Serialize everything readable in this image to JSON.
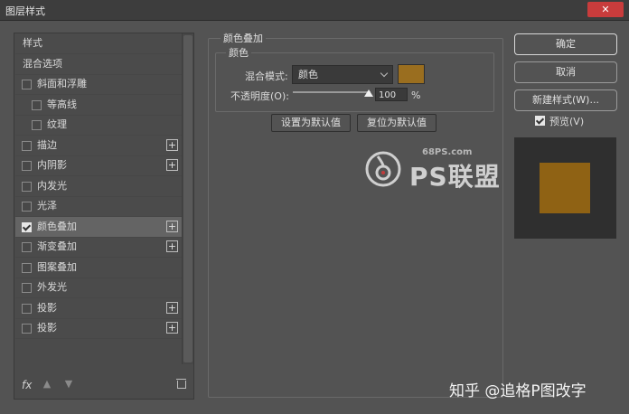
{
  "window": {
    "title": "图层样式",
    "close_label": "✕"
  },
  "left_panel": {
    "items": [
      {
        "label": "样式",
        "checkbox": false,
        "checked": false,
        "plus": false,
        "indent": 0,
        "selected": false
      },
      {
        "label": "混合选项",
        "checkbox": false,
        "checked": false,
        "plus": false,
        "indent": 0,
        "selected": false
      },
      {
        "label": "斜面和浮雕",
        "checkbox": true,
        "checked": false,
        "plus": false,
        "indent": 0,
        "selected": false
      },
      {
        "label": "等高线",
        "checkbox": true,
        "checked": false,
        "plus": false,
        "indent": 1,
        "selected": false
      },
      {
        "label": "纹理",
        "checkbox": true,
        "checked": false,
        "plus": false,
        "indent": 1,
        "selected": false
      },
      {
        "label": "描边",
        "checkbox": true,
        "checked": false,
        "plus": true,
        "indent": 0,
        "selected": false
      },
      {
        "label": "内阴影",
        "checkbox": true,
        "checked": false,
        "plus": true,
        "indent": 0,
        "selected": false
      },
      {
        "label": "内发光",
        "checkbox": true,
        "checked": false,
        "plus": false,
        "indent": 0,
        "selected": false
      },
      {
        "label": "光泽",
        "checkbox": true,
        "checked": false,
        "plus": false,
        "indent": 0,
        "selected": false
      },
      {
        "label": "颜色叠加",
        "checkbox": true,
        "checked": true,
        "plus": true,
        "indent": 0,
        "selected": true
      },
      {
        "label": "渐变叠加",
        "checkbox": true,
        "checked": false,
        "plus": true,
        "indent": 0,
        "selected": false
      },
      {
        "label": "图案叠加",
        "checkbox": true,
        "checked": false,
        "plus": false,
        "indent": 0,
        "selected": false
      },
      {
        "label": "外发光",
        "checkbox": true,
        "checked": false,
        "plus": false,
        "indent": 0,
        "selected": false
      },
      {
        "label": "投影",
        "checkbox": true,
        "checked": false,
        "plus": true,
        "indent": 0,
        "selected": false
      },
      {
        "label": "投影",
        "checkbox": true,
        "checked": false,
        "plus": true,
        "indent": 0,
        "selected": false
      }
    ],
    "footer": {
      "fx_label": "fx",
      "up_icon": "arrow-up-icon",
      "down_icon": "arrow-down-icon",
      "trash_icon": "trash-icon"
    }
  },
  "color_overlay": {
    "section_title": "颜色叠加",
    "group_title": "颜色",
    "blend_mode_label": "混合模式:",
    "blend_mode_value": "颜色",
    "overlay_color": "#9a6e1f",
    "opacity_label": "不透明度(O):",
    "opacity_value": "100",
    "opacity_unit": "%",
    "opacity_fraction": 1.0,
    "set_default_label": "设置为默认值",
    "reset_default_label": "复位为默认值"
  },
  "right_panel": {
    "ok_label": "确定",
    "cancel_label": "取消",
    "new_style_label": "新建样式(W)...",
    "preview_label": "预览(V)",
    "preview_checked": true,
    "preview_color": "#8f6214"
  },
  "watermark": {
    "site": "68PS.com",
    "brand": "PS联盟"
  },
  "credit": "知乎 @追格P图改字"
}
